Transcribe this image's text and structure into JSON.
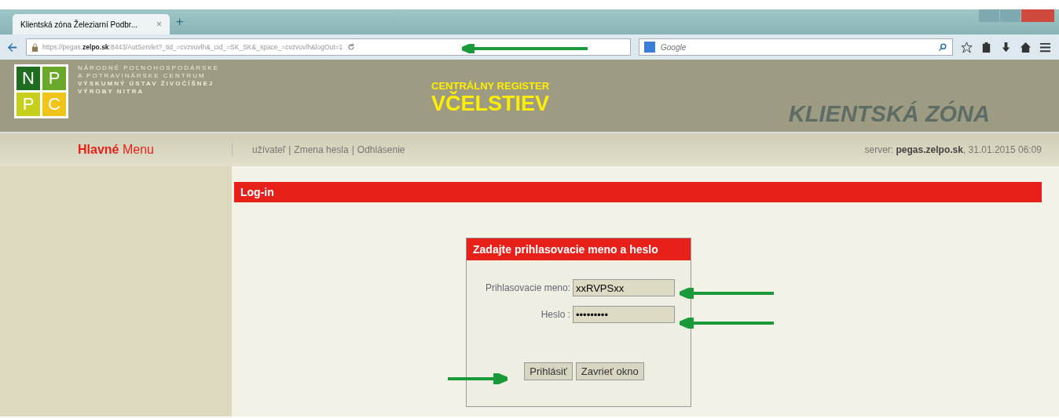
{
  "browser": {
    "tab": {
      "title": "Klientská zóna Železiarní Podbr...",
      "close": "×",
      "new_tab": "+"
    },
    "address": {
      "prefix": "https://pegas.",
      "host": "zelpo.sk",
      "rest": ":8443/AutServlet?_tid_=cvzvuvlh&_cid_=SK_SK&_space_=cvzvuvlh&logOut=1"
    },
    "search": {
      "placeholder": "Google"
    }
  },
  "header": {
    "org_lines": [
      "NÁRODNÉ POĽNOHOSPODÁRSKE",
      "A POTRAVINÁRSKE CENTRUM",
      "VÝSKUMNÝ ÚSTAV ŽIVOČÍŠNEJ",
      "VÝROBY NITRA"
    ],
    "logo_letters": [
      "N",
      "P",
      "P",
      "C"
    ],
    "register_small": "CENTRÁLNY REGISTER",
    "register_big": "VČELSTIEV",
    "zone": "KLIENTSKÁ ZÓNA"
  },
  "nav": {
    "menu_bold": "Hlavné",
    "menu_rest": "Menu",
    "links": [
      "užívateľ",
      "Zmena hesla",
      "Odhlásenie"
    ],
    "separator": "|",
    "server_label": "server:",
    "server": "pegas.zelpo.sk",
    "datetime": ", 31.01.2015 06:09"
  },
  "section_title": "Log-in",
  "login": {
    "title": "Zadajte prihlasovacie meno a heslo",
    "fields": [
      {
        "label": "Prihlasovacie meno:",
        "value": "xxRVPSxx"
      },
      {
        "label": "Heslo :",
        "value": "•••••••••"
      }
    ],
    "buttons": [
      "Prihlásiť",
      "Zavrieť okno"
    ]
  }
}
